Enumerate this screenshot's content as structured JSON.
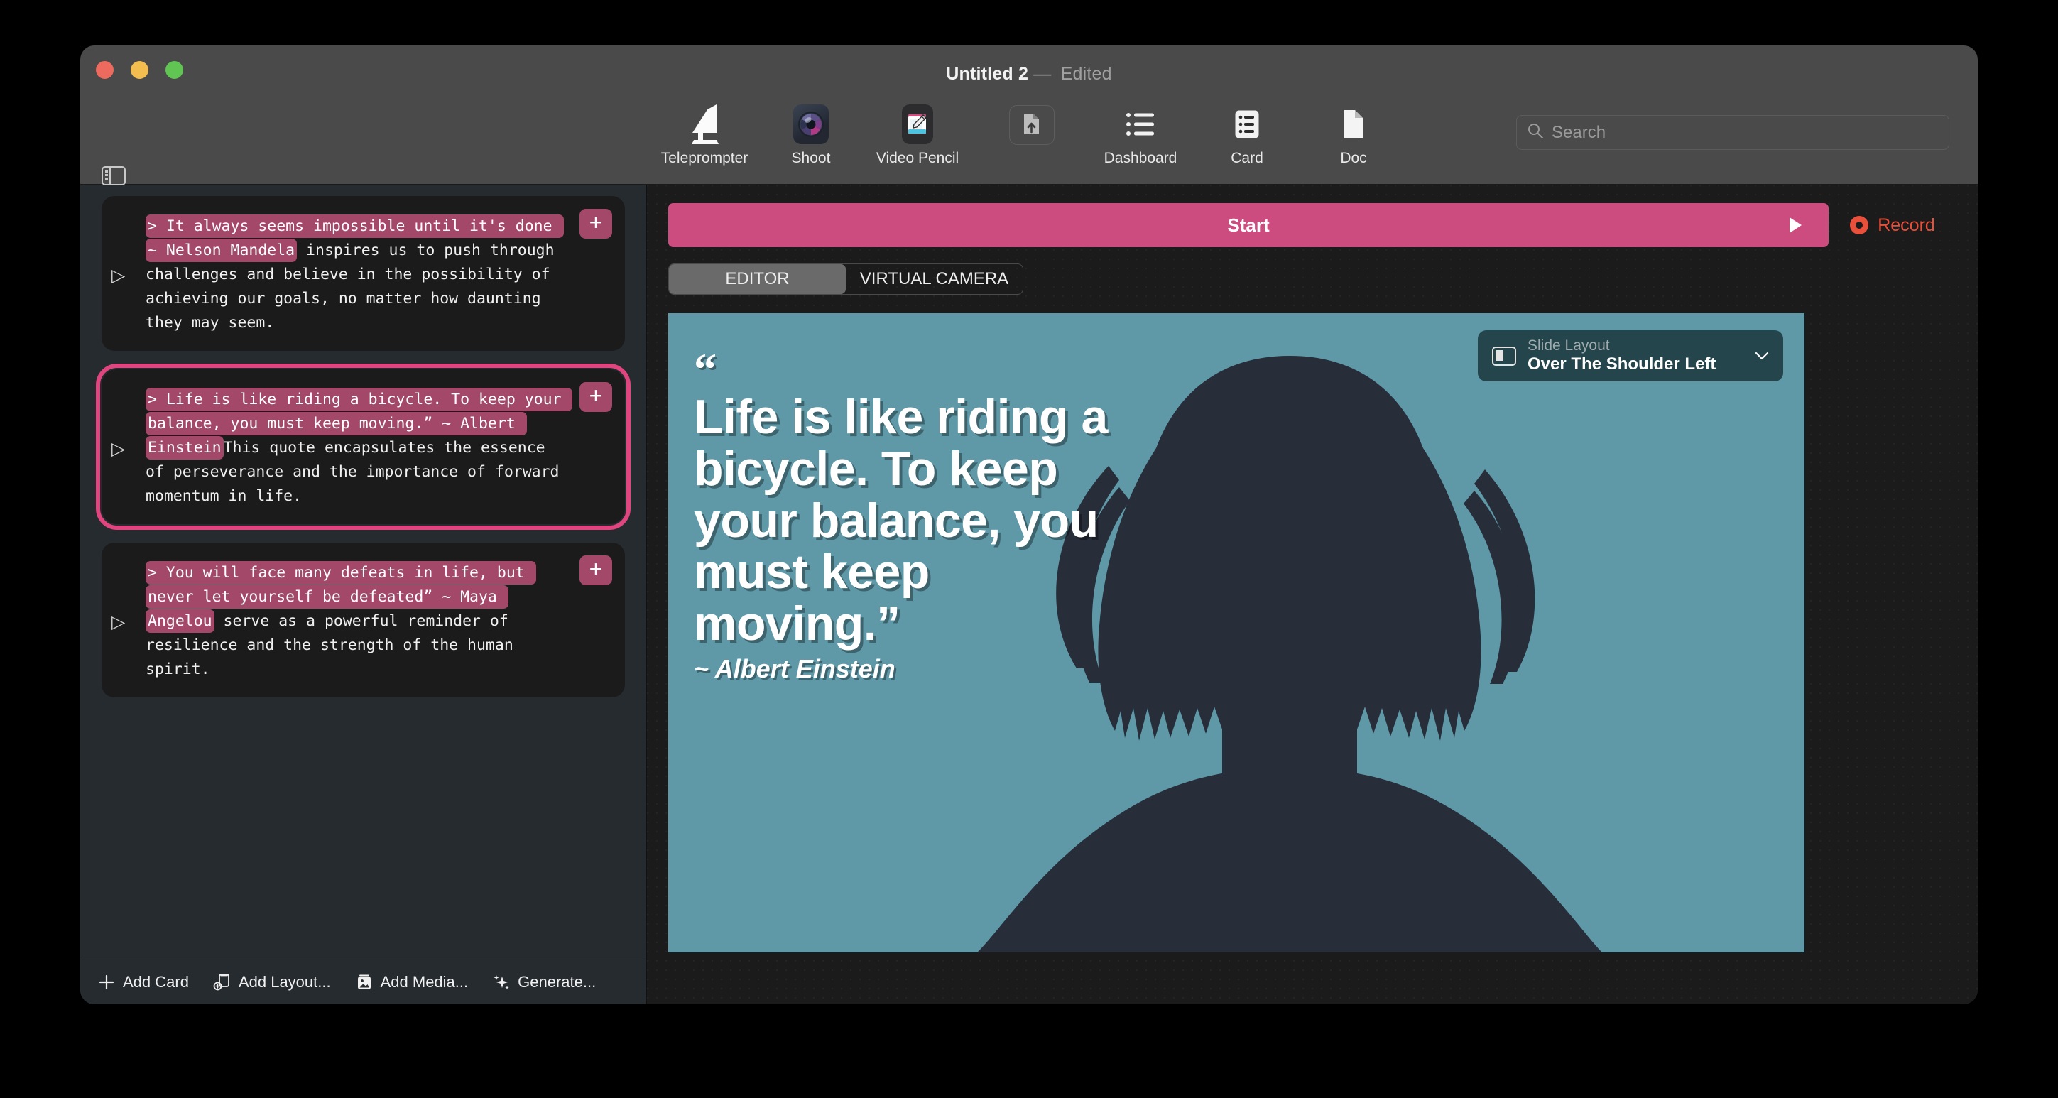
{
  "window": {
    "title": "Untitled 2",
    "dash": "—",
    "edited": "Edited",
    "traffic_lights": [
      "close",
      "minimize",
      "zoom"
    ]
  },
  "toolbar": {
    "items": [
      {
        "label": "Teleprompter",
        "icon": "teleprompter-icon"
      },
      {
        "label": "Shoot",
        "icon": "camera-aperture-icon"
      },
      {
        "label": "Video Pencil",
        "icon": "pencil-notepad-icon"
      },
      {
        "label": "Dashboard",
        "icon": "list-bullets-icon"
      },
      {
        "label": "Card",
        "icon": "card-list-icon"
      },
      {
        "label": "Doc",
        "icon": "document-icon"
      }
    ],
    "export_icon": "export-document-icon",
    "sidebar_toggle_icon": "sidebar-toggle-icon"
  },
  "search": {
    "placeholder": "Search",
    "value": "",
    "icon": "search-icon"
  },
  "transport": {
    "start_label": "Start",
    "start_icon": "play-triangle-icon",
    "record_label": "Record",
    "record_icon": "record-dot-icon",
    "start_color": "#cc4c80",
    "record_color": "#e8503c"
  },
  "tabs": {
    "items": [
      "EDITOR",
      "VIRTUAL CAMERA"
    ],
    "active": "EDITOR"
  },
  "sidebar": {
    "cards": [
      {
        "quote": "> It always seems impossible until it's done ~ Nelson Mandela",
        "body": " inspires us to push through challenges and believe in the possibility of achieving our goals, no matter how daunting they may seem.",
        "selected": false,
        "add_label": "+",
        "disclosure": "▷"
      },
      {
        "quote": "> Life is like riding a bicycle. To keep your balance, you must keep moving.” ~ Albert Einstein",
        "body": "This quote encapsulates the essence of perseverance and the importance of forward momentum in life.",
        "selected": true,
        "add_label": "+",
        "disclosure": "▷"
      },
      {
        "quote": "> You will face many defeats in life, but never let yourself be defeated” ~ Maya Angelou",
        "body": " serve as a powerful reminder of resilience and the strength of the human spirit.",
        "selected": false,
        "add_label": "+",
        "disclosure": "▷"
      }
    ],
    "bottom_actions": [
      {
        "label": "Add Card",
        "icon": "plus-icon"
      },
      {
        "label": "Add Layout...",
        "icon": "layout-stack-icon"
      },
      {
        "label": "Add Media...",
        "icon": "media-image-icon"
      },
      {
        "label": "Generate...",
        "icon": "sparkles-icon"
      }
    ]
  },
  "slide": {
    "background_color": "#5f99a8",
    "silhouette_color": "#282d3a",
    "open_quote": "“",
    "text": "Life is like riding a bicycle. To keep your balance, you must keep moving.”",
    "attribution": "~ Albert Einstein",
    "layout_pill": {
      "title": "Slide Layout",
      "value": "Over The Shoulder Left",
      "icon": "slide-layout-icon",
      "chevron": "chevron-down-icon"
    }
  }
}
